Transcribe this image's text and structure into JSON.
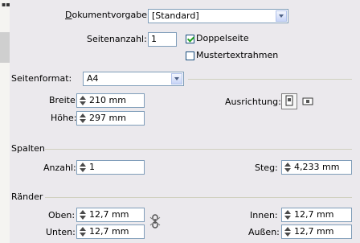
{
  "document": {
    "preset_label": "Dokumentvorgabe:",
    "preset_value": "[Standard]",
    "pages_label": "Seitenanzahl:",
    "pages_value": "1",
    "facing_pages_label": "Doppelseite",
    "facing_pages_checked": true,
    "master_text_frame_label": "Mustertextrahmen",
    "master_text_frame_checked": false
  },
  "page_size": {
    "label": "Seitenformat:",
    "value": "A4",
    "width_label": "Breite:",
    "width_value": "210 mm",
    "height_label": "Höhe:",
    "height_value": "297 mm",
    "orientation_label": "Ausrichtung:",
    "orientation_icons": [
      "portrait-orientation-icon",
      "landscape-orientation-icon"
    ]
  },
  "columns": {
    "heading": "Spalten",
    "count_label": "Anzahl:",
    "count_value": "1",
    "gutter_label": "Steg:",
    "gutter_value": "4,233 mm"
  },
  "margins": {
    "heading": "Ränder",
    "top_label": "Oben:",
    "top_value": "12,7 mm",
    "bottom_label": "Unten:",
    "bottom_value": "12,7 mm",
    "inside_label": "Innen:",
    "inside_value": "12,7 mm",
    "outside_label": "Außen:",
    "outside_value": "12,7 mm",
    "link_icon": "chain-link-icon"
  },
  "colors": {
    "field_border": "#7f9db9",
    "panel_background": "#ebe9ed",
    "check_color": "#21a121"
  }
}
